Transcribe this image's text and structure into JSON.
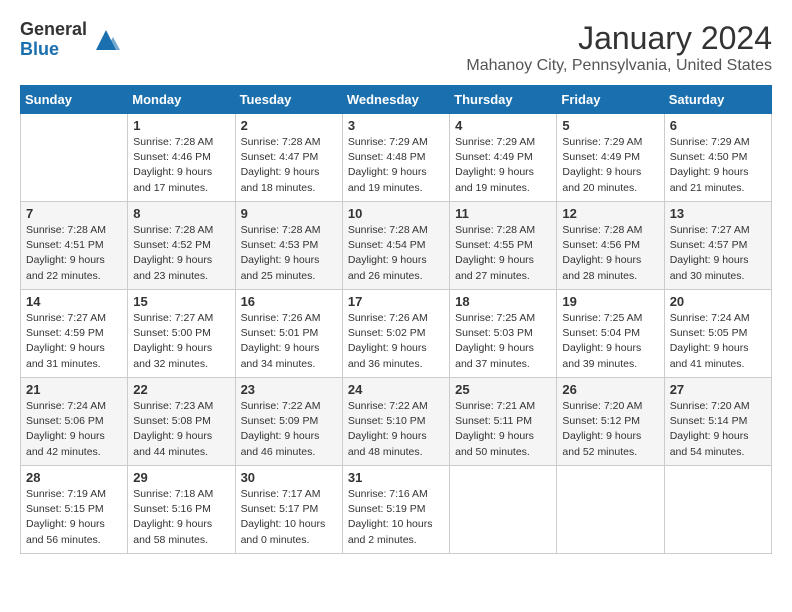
{
  "header": {
    "logo_general": "General",
    "logo_blue": "Blue",
    "month_title": "January 2024",
    "location": "Mahanoy City, Pennsylvania, United States"
  },
  "days_of_week": [
    "Sunday",
    "Monday",
    "Tuesday",
    "Wednesday",
    "Thursday",
    "Friday",
    "Saturday"
  ],
  "weeks": [
    [
      {
        "day": "",
        "info": ""
      },
      {
        "day": "1",
        "info": "Sunrise: 7:28 AM\nSunset: 4:46 PM\nDaylight: 9 hours\nand 17 minutes."
      },
      {
        "day": "2",
        "info": "Sunrise: 7:28 AM\nSunset: 4:47 PM\nDaylight: 9 hours\nand 18 minutes."
      },
      {
        "day": "3",
        "info": "Sunrise: 7:29 AM\nSunset: 4:48 PM\nDaylight: 9 hours\nand 19 minutes."
      },
      {
        "day": "4",
        "info": "Sunrise: 7:29 AM\nSunset: 4:49 PM\nDaylight: 9 hours\nand 19 minutes."
      },
      {
        "day": "5",
        "info": "Sunrise: 7:29 AM\nSunset: 4:49 PM\nDaylight: 9 hours\nand 20 minutes."
      },
      {
        "day": "6",
        "info": "Sunrise: 7:29 AM\nSunset: 4:50 PM\nDaylight: 9 hours\nand 21 minutes."
      }
    ],
    [
      {
        "day": "7",
        "info": "Sunrise: 7:28 AM\nSunset: 4:51 PM\nDaylight: 9 hours\nand 22 minutes."
      },
      {
        "day": "8",
        "info": "Sunrise: 7:28 AM\nSunset: 4:52 PM\nDaylight: 9 hours\nand 23 minutes."
      },
      {
        "day": "9",
        "info": "Sunrise: 7:28 AM\nSunset: 4:53 PM\nDaylight: 9 hours\nand 25 minutes."
      },
      {
        "day": "10",
        "info": "Sunrise: 7:28 AM\nSunset: 4:54 PM\nDaylight: 9 hours\nand 26 minutes."
      },
      {
        "day": "11",
        "info": "Sunrise: 7:28 AM\nSunset: 4:55 PM\nDaylight: 9 hours\nand 27 minutes."
      },
      {
        "day": "12",
        "info": "Sunrise: 7:28 AM\nSunset: 4:56 PM\nDaylight: 9 hours\nand 28 minutes."
      },
      {
        "day": "13",
        "info": "Sunrise: 7:27 AM\nSunset: 4:57 PM\nDaylight: 9 hours\nand 30 minutes."
      }
    ],
    [
      {
        "day": "14",
        "info": "Sunrise: 7:27 AM\nSunset: 4:59 PM\nDaylight: 9 hours\nand 31 minutes."
      },
      {
        "day": "15",
        "info": "Sunrise: 7:27 AM\nSunset: 5:00 PM\nDaylight: 9 hours\nand 32 minutes."
      },
      {
        "day": "16",
        "info": "Sunrise: 7:26 AM\nSunset: 5:01 PM\nDaylight: 9 hours\nand 34 minutes."
      },
      {
        "day": "17",
        "info": "Sunrise: 7:26 AM\nSunset: 5:02 PM\nDaylight: 9 hours\nand 36 minutes."
      },
      {
        "day": "18",
        "info": "Sunrise: 7:25 AM\nSunset: 5:03 PM\nDaylight: 9 hours\nand 37 minutes."
      },
      {
        "day": "19",
        "info": "Sunrise: 7:25 AM\nSunset: 5:04 PM\nDaylight: 9 hours\nand 39 minutes."
      },
      {
        "day": "20",
        "info": "Sunrise: 7:24 AM\nSunset: 5:05 PM\nDaylight: 9 hours\nand 41 minutes."
      }
    ],
    [
      {
        "day": "21",
        "info": "Sunrise: 7:24 AM\nSunset: 5:06 PM\nDaylight: 9 hours\nand 42 minutes."
      },
      {
        "day": "22",
        "info": "Sunrise: 7:23 AM\nSunset: 5:08 PM\nDaylight: 9 hours\nand 44 minutes."
      },
      {
        "day": "23",
        "info": "Sunrise: 7:22 AM\nSunset: 5:09 PM\nDaylight: 9 hours\nand 46 minutes."
      },
      {
        "day": "24",
        "info": "Sunrise: 7:22 AM\nSunset: 5:10 PM\nDaylight: 9 hours\nand 48 minutes."
      },
      {
        "day": "25",
        "info": "Sunrise: 7:21 AM\nSunset: 5:11 PM\nDaylight: 9 hours\nand 50 minutes."
      },
      {
        "day": "26",
        "info": "Sunrise: 7:20 AM\nSunset: 5:12 PM\nDaylight: 9 hours\nand 52 minutes."
      },
      {
        "day": "27",
        "info": "Sunrise: 7:20 AM\nSunset: 5:14 PM\nDaylight: 9 hours\nand 54 minutes."
      }
    ],
    [
      {
        "day": "28",
        "info": "Sunrise: 7:19 AM\nSunset: 5:15 PM\nDaylight: 9 hours\nand 56 minutes."
      },
      {
        "day": "29",
        "info": "Sunrise: 7:18 AM\nSunset: 5:16 PM\nDaylight: 9 hours\nand 58 minutes."
      },
      {
        "day": "30",
        "info": "Sunrise: 7:17 AM\nSunset: 5:17 PM\nDaylight: 10 hours\nand 0 minutes."
      },
      {
        "day": "31",
        "info": "Sunrise: 7:16 AM\nSunset: 5:19 PM\nDaylight: 10 hours\nand 2 minutes."
      },
      {
        "day": "",
        "info": ""
      },
      {
        "day": "",
        "info": ""
      },
      {
        "day": "",
        "info": ""
      }
    ]
  ]
}
